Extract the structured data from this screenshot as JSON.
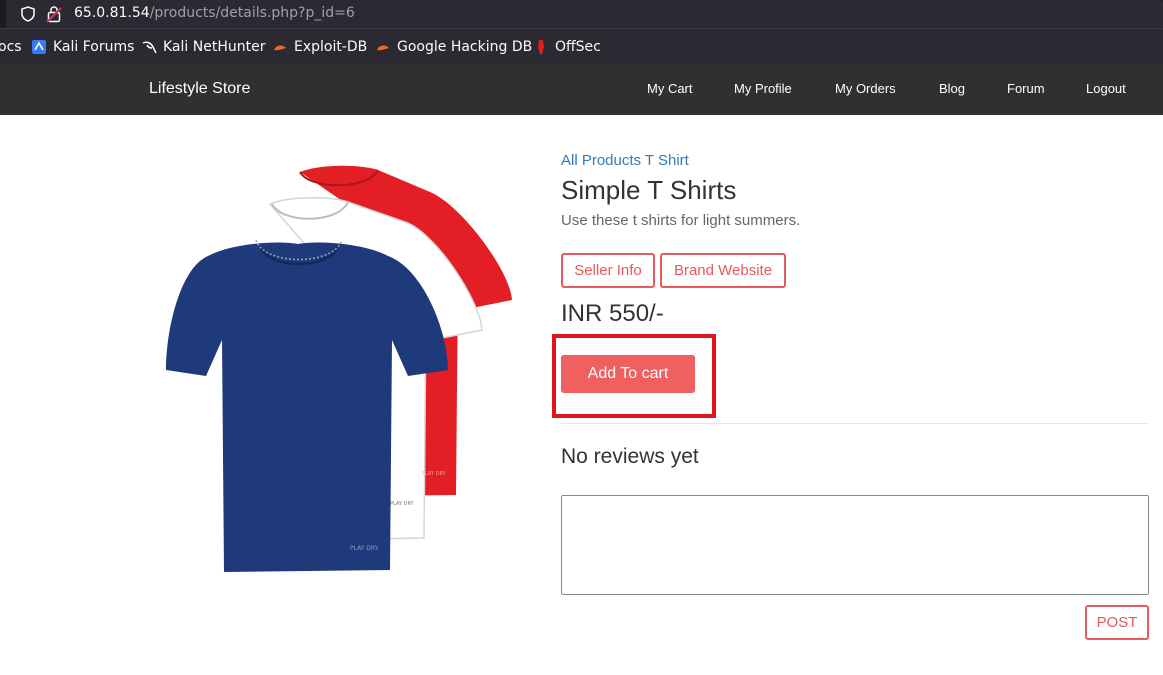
{
  "browser": {
    "url_host": "65.0.81.54",
    "url_path": "/products/details.php?p_id=6",
    "bookmarks": [
      {
        "label": "ocs",
        "icon": "docs-icon"
      },
      {
        "label": "Kali Forums",
        "icon": "kali-forums-icon"
      },
      {
        "label": "Kali NetHunter",
        "icon": "kali-dragon-icon"
      },
      {
        "label": "Exploit-DB",
        "icon": "exploit-db-icon"
      },
      {
        "label": "Google Hacking DB",
        "icon": "ghdb-icon"
      },
      {
        "label": "OffSec",
        "icon": "offsec-icon"
      }
    ]
  },
  "navbar": {
    "brand": "Lifestyle Store",
    "links": [
      "My Cart",
      "My Profile",
      "My Orders",
      "Blog",
      "Forum",
      "Logout"
    ],
    "bg_color": "#303030"
  },
  "product": {
    "breadcrumb": "All Products T Shirt",
    "title": "Simple T Shirts",
    "description": "Use these t shirts for light summers.",
    "seller_info_label": "Seller Info",
    "brand_website_label": "Brand Website",
    "price": "INR 550/-",
    "add_to_cart_label": "Add To cart",
    "image_icon": "tshirts-image",
    "shirt_colors": [
      "#e31e24",
      "#ffffff",
      "#1f3a7a"
    ]
  },
  "reviews": {
    "heading": "No reviews yet",
    "input_value": "",
    "post_label": "POST"
  },
  "colors": {
    "accent": "#e8595b",
    "button_fill": "#f06060",
    "highlight_border": "#e0161e",
    "link": "#337ab7"
  }
}
